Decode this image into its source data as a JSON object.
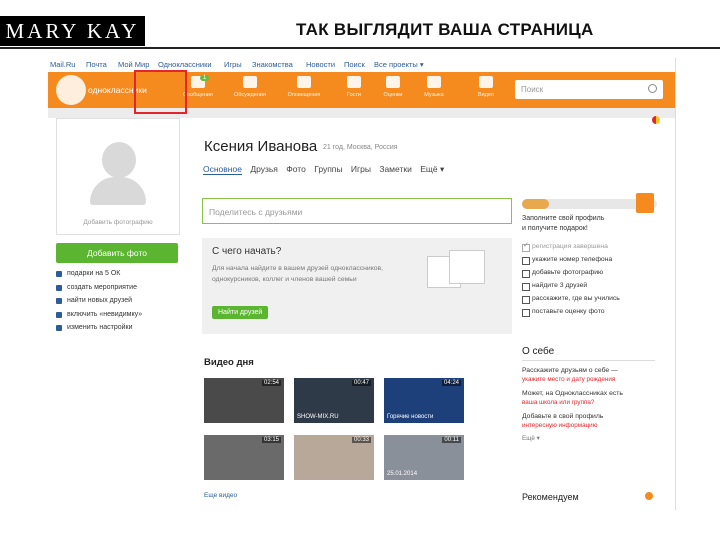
{
  "slide": {
    "brand": "MARY KAY",
    "title": "ТАК ВЫГЛЯДИТ ВАША СТРАНИЦА"
  },
  "topnav": [
    "Mail.Ru",
    "Почта",
    "Мой Мир",
    "Одноклассники",
    "Игры",
    "Знакомства",
    "Новости",
    "Поиск",
    "Все проекты ▾"
  ],
  "header": {
    "logo_text": "одноклассники",
    "items": [
      {
        "label": "Сообщения",
        "icon": "envelope-icon",
        "badge": "1"
      },
      {
        "label": "Обсуждения",
        "icon": "chat-bubbles-icon"
      },
      {
        "label": "Оповещения",
        "icon": "bell-icon"
      },
      {
        "label": "Гости",
        "icon": "footprints-icon"
      },
      {
        "label": "Оценки",
        "icon": "rating-icon"
      },
      {
        "label": "Музыка",
        "icon": "music-note-icon"
      },
      {
        "label": "Видео",
        "icon": "video-icon"
      }
    ],
    "search_placeholder": "Поиск"
  },
  "profile": {
    "avatar_caption": "Добавить фотографию",
    "add_photo": "Добавить фото",
    "left_menu": [
      "подарки на 5 ОК",
      "создать мероприятие",
      "найти новых друзей",
      "включить «невидимку»",
      "изменить настройки"
    ],
    "name": "Ксения Иванова",
    "meta": "21 год, Москва, Россия",
    "tabs": [
      "Основное",
      "Друзья",
      "Фото",
      "Группы",
      "Игры",
      "Заметки",
      "Ещё ▾"
    ],
    "share_placeholder": "Поделитесь с друзьями"
  },
  "start": {
    "title": "С чего начать?",
    "desc": "Для начала найдите в вашем друзей одноклассников, однокурсников, коллег и членов вашей семьи",
    "button": "Найти друзей"
  },
  "video": {
    "title": "Видео дня",
    "items": [
      {
        "duration": "02:54",
        "caption": "",
        "color": "#4a4a4a"
      },
      {
        "duration": "00:47",
        "caption": "SHOW-MIX.RU",
        "color": "#2f3a48"
      },
      {
        "duration": "04:24",
        "caption": "Горячие новости",
        "color": "#1d3f7a"
      },
      {
        "duration": "03:15",
        "caption": "",
        "color": "#6a6a6a"
      },
      {
        "duration": "00:33",
        "caption": "",
        "color": "#b8a89a"
      },
      {
        "duration": "00:11",
        "caption": "25.01.2014",
        "color": "#8a9099"
      }
    ],
    "all": "Еще видео"
  },
  "sidebar": {
    "progress_fraction": 0.2,
    "fill_profile": [
      "Заполните свой профиль",
      "и получите подарок!"
    ],
    "checklist": [
      {
        "label": "регистрация завершена",
        "done": true
      },
      {
        "label": "укажите номер телефона",
        "done": false
      },
      {
        "label": "добавьте фотографию",
        "done": false
      },
      {
        "label": "найдите 3 друзей",
        "done": false
      },
      {
        "label": "расскажите, где вы учились",
        "done": false
      },
      {
        "label": "поставьте оценку фото",
        "done": false
      }
    ],
    "about_title": "О себе",
    "about": [
      {
        "q": "Расскажите друзьям о себе —",
        "a": "укажите место и дату рождения"
      },
      {
        "q": "Может, на Одноклассниках есть",
        "a": "ваша школа или группа?"
      },
      {
        "q": "Добавьте в свой профиль",
        "a": "интересную информацию"
      }
    ],
    "about_more": "Ещё ▾",
    "recommend": "Рекомендуем"
  }
}
